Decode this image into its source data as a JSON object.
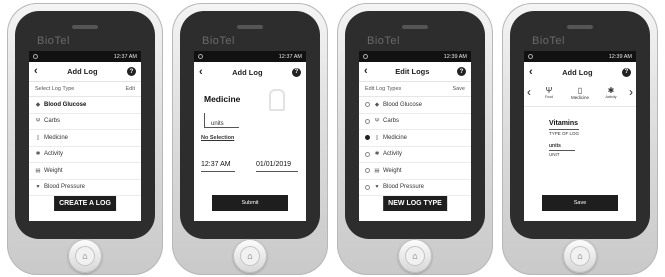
{
  "brand": "BioTel",
  "screens": [
    {
      "time": "12:37 AM",
      "title": "Add Log",
      "sub_left": "Select Log Type",
      "sub_right": "Edit",
      "items": [
        {
          "label": "Blood Glucose",
          "icon": "drop-icon",
          "glyph": "◆",
          "active": true
        },
        {
          "label": "Carbs",
          "icon": "fork-icon",
          "glyph": "Ψ"
        },
        {
          "label": "Medicine",
          "icon": "pill-icon",
          "glyph": "▯"
        },
        {
          "label": "Activity",
          "icon": "runner-icon",
          "glyph": "✱"
        },
        {
          "label": "Weight",
          "icon": "scale-icon",
          "glyph": "▤"
        },
        {
          "label": "Blood Pressure",
          "icon": "bp-icon",
          "glyph": "♥"
        }
      ],
      "button": "CREATE A LOG"
    },
    {
      "time": "12:37 AM",
      "title": "Add Log",
      "log_name": "Medicine",
      "units_label": "units",
      "selection_text": "No Selection",
      "time_value": "12:37 AM",
      "date_value": "01/01/2019",
      "button": "Submit"
    },
    {
      "time": "12:39 AM",
      "title": "Edit Logs",
      "sub_left": "Edit Log Types",
      "sub_right": "Save",
      "items": [
        {
          "label": "Blood Glucose",
          "icon": "drop-icon",
          "glyph": "◆",
          "checked": false
        },
        {
          "label": "Carbs",
          "icon": "fork-icon",
          "glyph": "Ψ",
          "checked": false
        },
        {
          "label": "Medicine",
          "icon": "pill-icon",
          "glyph": "▯",
          "checked": true
        },
        {
          "label": "Activity",
          "icon": "runner-icon",
          "glyph": "✱",
          "checked": false
        },
        {
          "label": "Weight",
          "icon": "scale-icon",
          "glyph": "▤",
          "checked": false
        },
        {
          "label": "Blood Pressure",
          "icon": "bp-icon",
          "glyph": "♥",
          "checked": false
        }
      ],
      "button": "NEW LOG TYPE"
    },
    {
      "time": "12:39 AM",
      "title": "Add Log",
      "tabs": [
        {
          "label": "Food",
          "icon": "fork-icon",
          "glyph": "Ψ"
        },
        {
          "label": "Medicine",
          "icon": "pill-icon",
          "glyph": "▯"
        },
        {
          "label": "Activity",
          "icon": "runner-icon",
          "glyph": "✱"
        }
      ],
      "type_value": "Vitamins",
      "type_label": "TYPE OF LOG",
      "unit_value": "units",
      "unit_label": "UNIT",
      "button": "Save"
    }
  ]
}
